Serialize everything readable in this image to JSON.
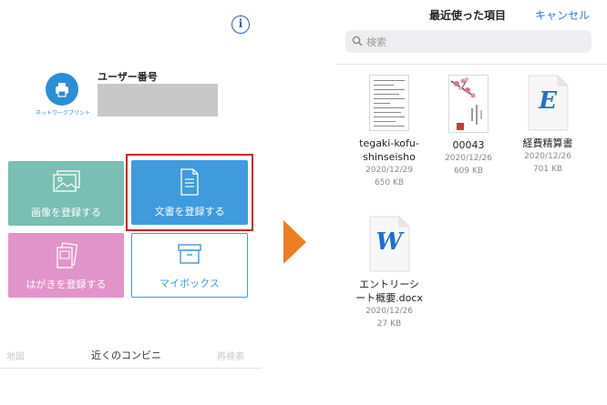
{
  "left_screen": {
    "logo_text": "ネットワークプリント",
    "user_label": "ユーザー番号",
    "tiles": {
      "image": "画像を登録する",
      "document": "文書を登録する",
      "postcard": "はがきを登録する",
      "mybox": "マイボックス"
    },
    "bottom_nav": {
      "map": "地図",
      "nearby": "近くのコンビニ",
      "research": "再検索"
    }
  },
  "right_screen": {
    "title": "最近使った項目",
    "cancel": "キャンセル",
    "search_placeholder": "検索",
    "files": [
      {
        "name_line1": "tegaki-kofu-",
        "name_line2": "shinseisho",
        "date": "2020/12/29",
        "size": "650 KB"
      },
      {
        "name_line1": "00043",
        "name_line2": "",
        "date": "2020/12/26",
        "size": "609 KB"
      },
      {
        "name_line1": "経費精算書",
        "name_line2": "",
        "date": "2020/12/26",
        "size": "701 KB",
        "icon_letter": "E"
      },
      {
        "name_line1": "エントリーシ",
        "name_line2": "ート概要.docx",
        "date": "2020/12/26",
        "size": "27 KB",
        "icon_letter": "W"
      }
    ]
  },
  "colors": {
    "image_tile": "#79bfb3",
    "document_tile": "#3f9bdc",
    "postcard_tile": "#e194c9",
    "highlight_frame": "#d21d1d",
    "arrow": "#ee7d22",
    "link": "#2e7ad1"
  }
}
